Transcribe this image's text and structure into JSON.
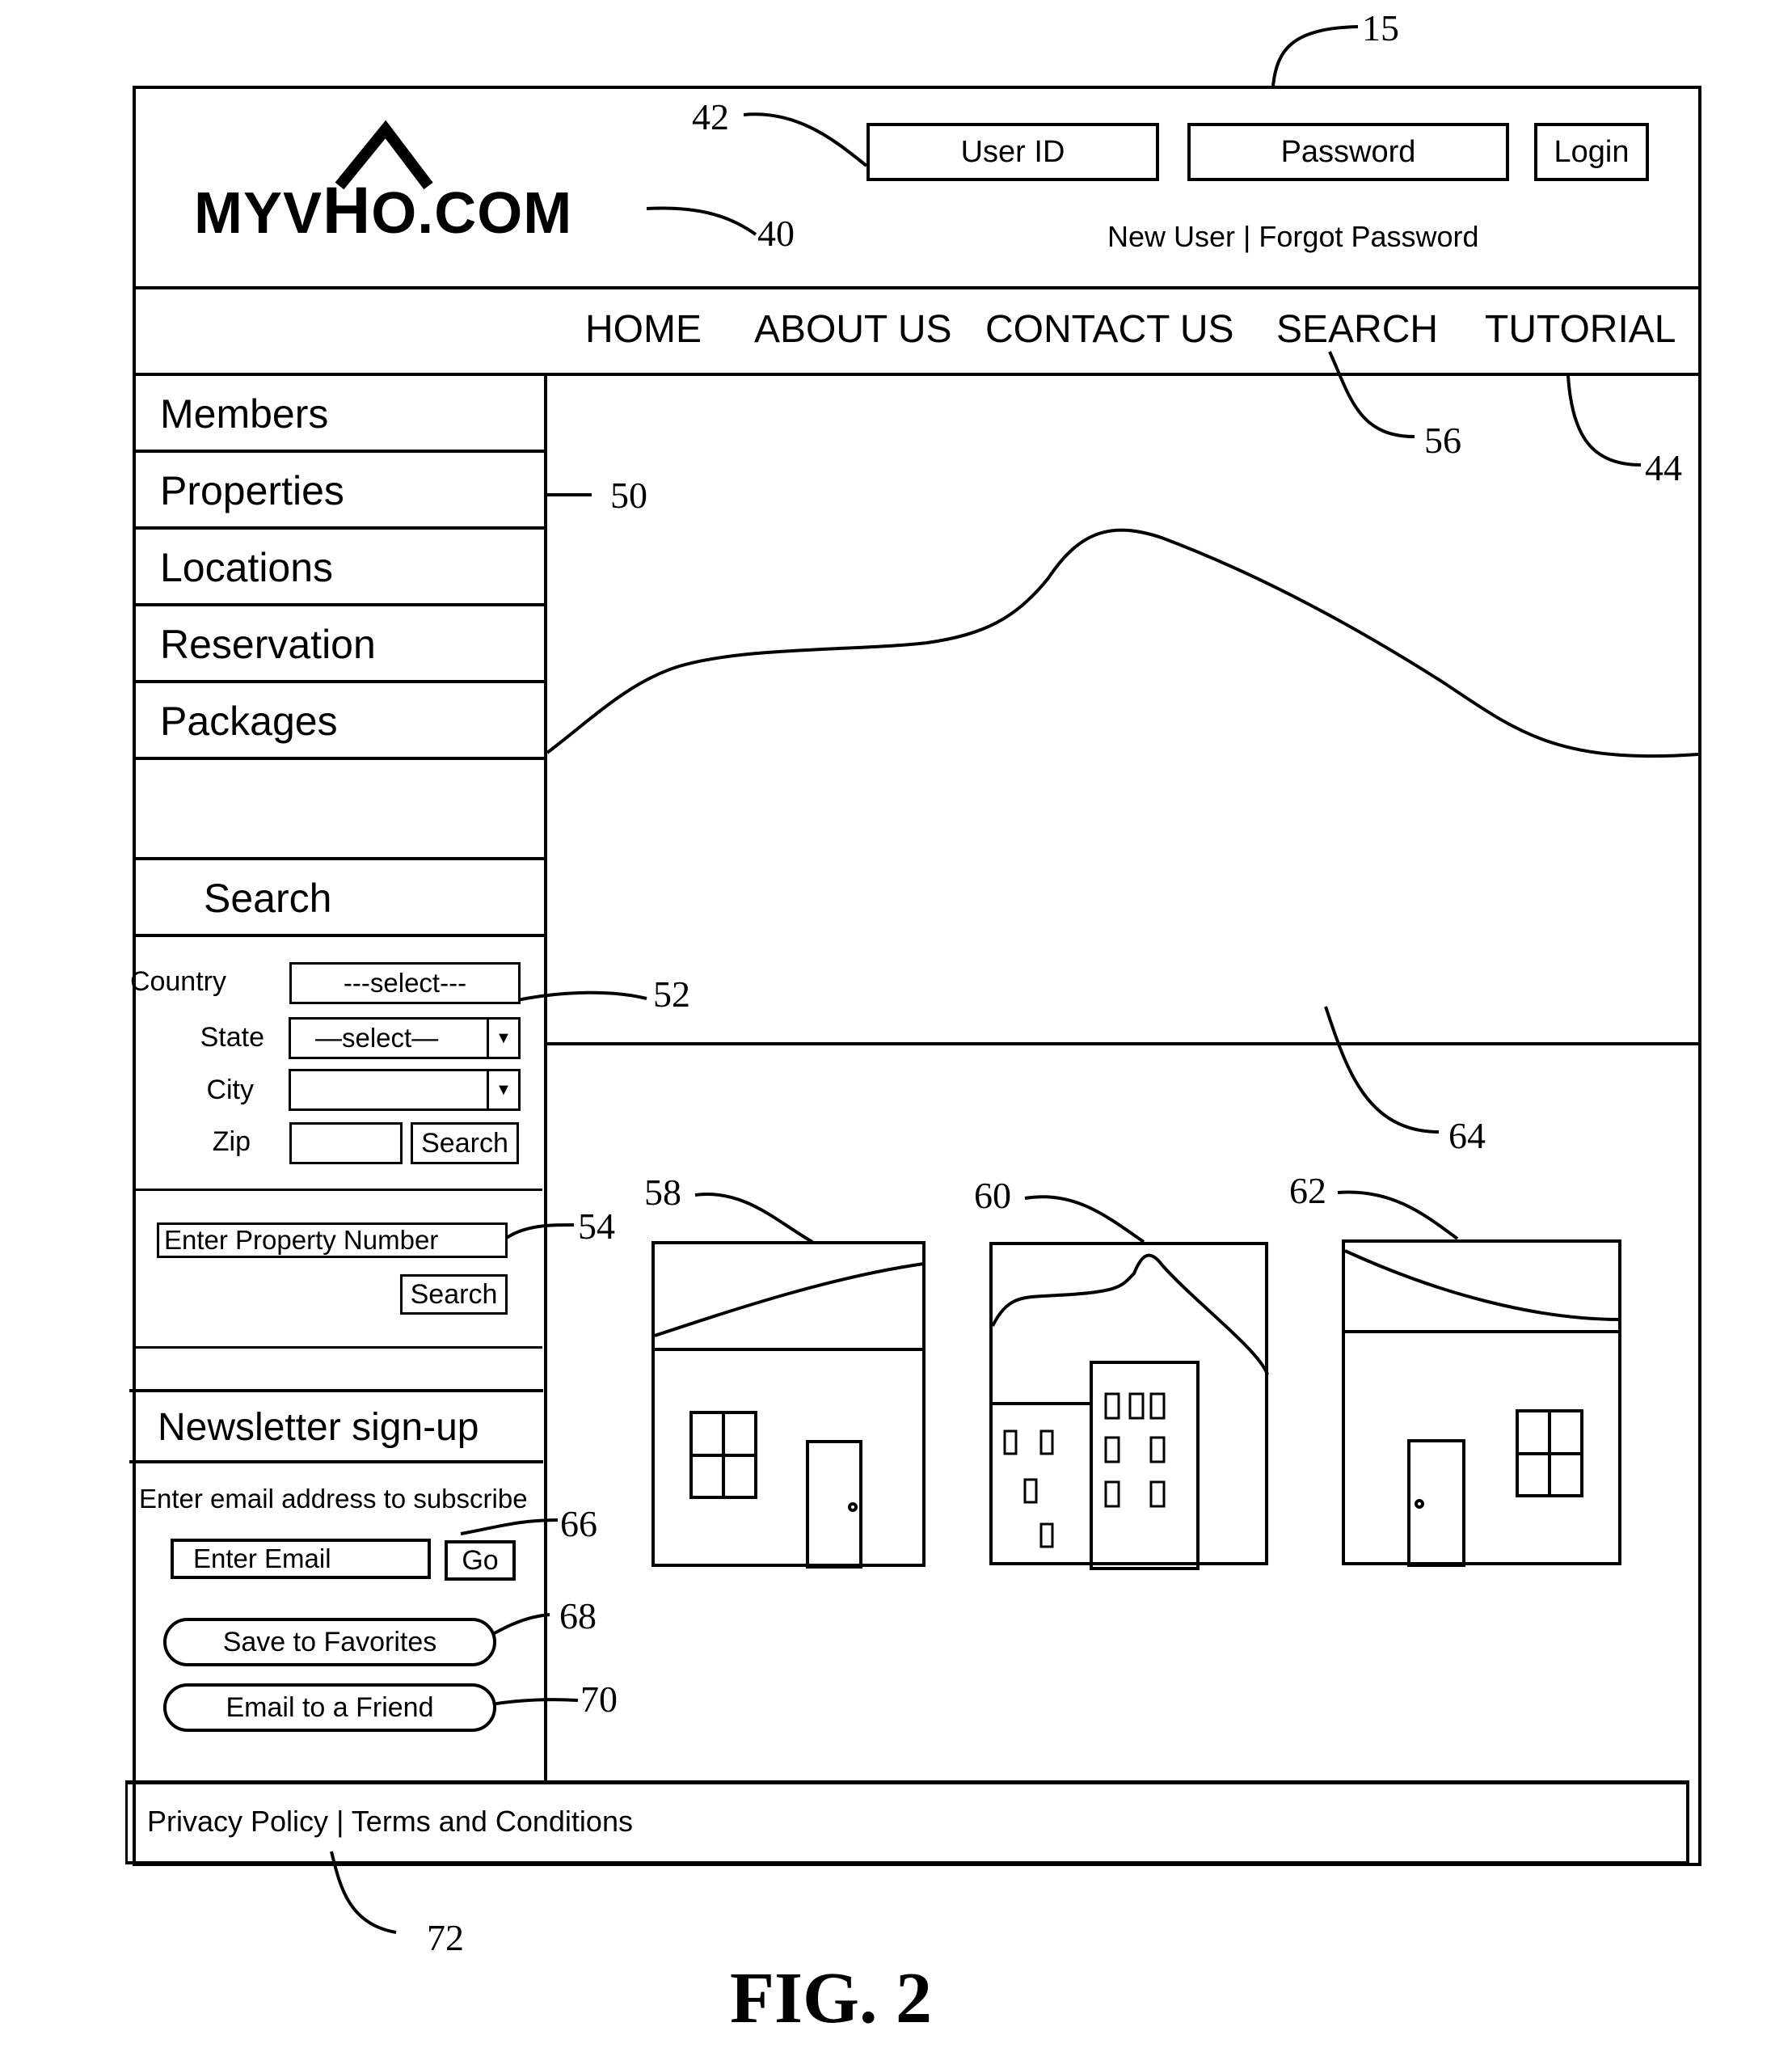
{
  "figure": {
    "caption": "FIG. 2",
    "reference_numerals": {
      "page": "15",
      "logo": "40",
      "login_fields": "42",
      "nav_bar": "44",
      "sidebar_menu": "50",
      "location_search": "52",
      "property_number_search": "54",
      "search_nav": "56",
      "property_1": "58",
      "property_2": "60",
      "property_3": "62",
      "hero_image": "64",
      "newsletter_go": "66",
      "save_favorites": "68",
      "email_friend": "70",
      "footer_links": "72"
    }
  },
  "header": {
    "logo_text": "MYVHO.COM",
    "logo_prefix": "MYV",
    "logo_house_letter": "H",
    "logo_suffix": "O.COM",
    "user_id_placeholder": "User ID",
    "password_placeholder": "Password",
    "login_label": "Login",
    "new_user_link": "New User",
    "separator": "|",
    "forgot_password_link": "Forgot Password"
  },
  "nav": {
    "items": [
      {
        "label": "HOME"
      },
      {
        "label": "ABOUT US"
      },
      {
        "label": "CONTACT US"
      },
      {
        "label": "SEARCH"
      },
      {
        "label": "TUTORIAL"
      }
    ]
  },
  "sidebar": {
    "items": [
      {
        "label": "Members"
      },
      {
        "label": "Properties"
      },
      {
        "label": "Locations"
      },
      {
        "label": "Reservation"
      },
      {
        "label": "Packages"
      }
    ],
    "search": {
      "title": "Search",
      "country_label": "Country",
      "country_value": "---select---",
      "state_label": "State",
      "state_value": "—select—",
      "city_label": "City",
      "city_value": "",
      "zip_label": "Zip",
      "zip_value": "",
      "search_button": "Search",
      "property_number_placeholder": "Enter Property Number",
      "property_search_button": "Search"
    },
    "newsletter": {
      "title": "Newsletter sign-up",
      "instruction": "Enter email address to subscribe",
      "email_placeholder": "Enter Email",
      "go_button": "Go",
      "save_favorites_button": "Save to Favorites",
      "email_friend_button": "Email to a Friend"
    }
  },
  "main": {
    "properties": [
      {
        "type": "house",
        "ref": "58"
      },
      {
        "type": "apartment-buildings",
        "ref": "60"
      },
      {
        "type": "house",
        "ref": "62"
      }
    ]
  },
  "footer": {
    "privacy_link": "Privacy Policy",
    "separator": "|",
    "terms_link": "Terms and Conditions"
  }
}
